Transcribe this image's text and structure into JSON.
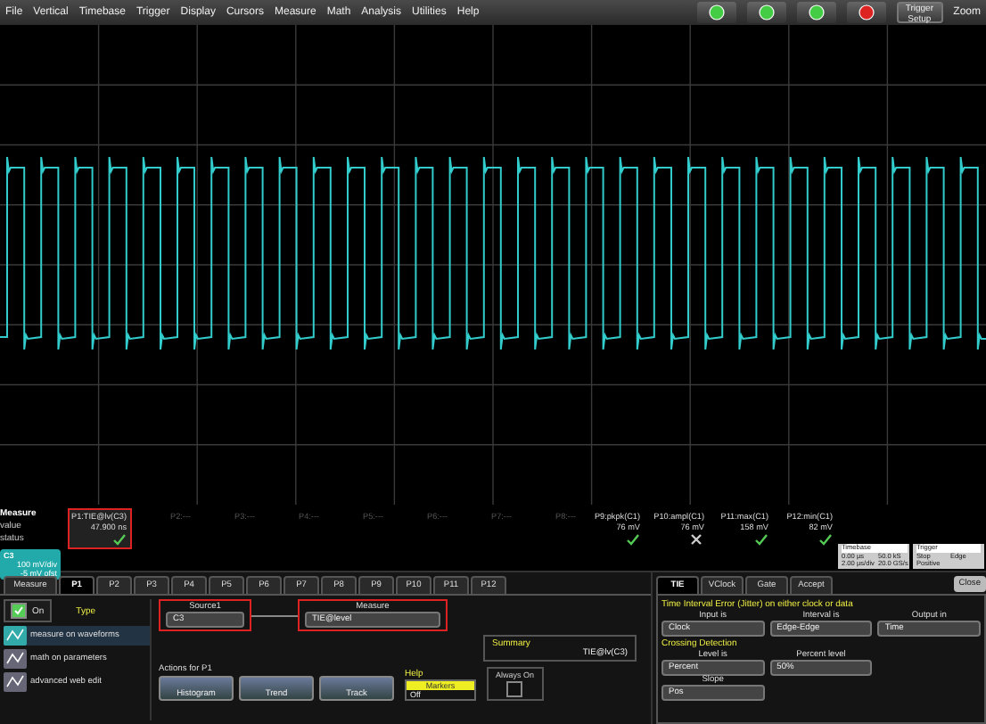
{
  "menu": [
    "File",
    "Vertical",
    "Timebase",
    "Trigger",
    "Display",
    "Cursors",
    "Measure",
    "Math",
    "Analysis",
    "Utilities",
    "Help"
  ],
  "toolbar": {
    "trigger_setup": "Trigger Setup",
    "zoom": "Zoom"
  },
  "measure_table": {
    "row_labels": [
      "Measure",
      "value",
      "status"
    ],
    "params": [
      {
        "label": "P1:TIE@lv(C3)",
        "value": "47.900 ns",
        "passed": true,
        "selected": true
      },
      {
        "label": "P2:---",
        "selected": false
      },
      {
        "label": "P3:---",
        "selected": false
      },
      {
        "label": "P4:---",
        "selected": false
      },
      {
        "label": "P5:---",
        "selected": false
      },
      {
        "label": "P6:---",
        "selected": false
      },
      {
        "label": "P7:---",
        "selected": false
      },
      {
        "label": "P8:---",
        "selected": false
      },
      {
        "label": "P9:pkpk(C1)",
        "value": "76 mV",
        "passed": true,
        "selected": false
      },
      {
        "label": "P10:ampl(C1)",
        "value": "76 mV",
        "passed": false,
        "selected": false
      },
      {
        "label": "P11:max(C1)",
        "value": "158 mV",
        "passed": true,
        "selected": false
      },
      {
        "label": "P12:min(C1)",
        "value": "82 mV",
        "passed": true,
        "selected": false
      }
    ]
  },
  "channel": {
    "name": "C3",
    "lines": [
      "100 mV/div",
      "-5 mV ofst"
    ]
  },
  "timebase": {
    "title": "Timebase",
    "cells": [
      "0.00 µs",
      "50.0 kS",
      "2.00 µs/div",
      "20.0 GS/s"
    ]
  },
  "trigger": {
    "title": "Trigger",
    "cells": [
      "Stop",
      "Edge",
      "Positive"
    ]
  },
  "tabs": [
    {
      "label": "Measure",
      "selected": false
    },
    {
      "label": "P1",
      "selected": true
    },
    {
      "label": "P2",
      "selected": false
    },
    {
      "label": "P3",
      "selected": false
    },
    {
      "label": "P4",
      "selected": false
    },
    {
      "label": "P5",
      "selected": false
    },
    {
      "label": "P6",
      "selected": false
    },
    {
      "label": "P7",
      "selected": false
    },
    {
      "label": "P8",
      "selected": false
    },
    {
      "label": "P9",
      "selected": false
    },
    {
      "label": "P10",
      "selected": false
    },
    {
      "label": "P11",
      "selected": false
    },
    {
      "label": "P12",
      "selected": false
    }
  ],
  "on": {
    "label": "On",
    "checked": true
  },
  "type_label": "Type",
  "types": [
    {
      "label": "measure on waveforms",
      "selected": true
    },
    {
      "label": "math on parameters",
      "selected": false
    },
    {
      "label": "advanced web edit",
      "selected": false
    }
  ],
  "source": {
    "label": "Source1",
    "value": "C3"
  },
  "measure": {
    "label": "Measure",
    "value": "TIE@level"
  },
  "summary": {
    "label": "Summary",
    "value": "TIE@lv(C3)"
  },
  "actions_label": "Actions for P1",
  "actions": [
    "Histogram",
    "Trend",
    "Track"
  ],
  "help": {
    "label": "Help",
    "markers_label": "Markers",
    "markers_value": "Off"
  },
  "always_on": {
    "label": "Always On",
    "checked": false
  },
  "sub_tabs": [
    {
      "label": "TIE",
      "selected": true
    },
    {
      "label": "VClock",
      "selected": false
    },
    {
      "label": "Gate",
      "selected": false
    },
    {
      "label": "Accept",
      "selected": false
    }
  ],
  "close": "Close",
  "description": "Time Interval Error (Jitter) on either clock or data",
  "fields": [
    {
      "label": "Input is",
      "value": "Clock"
    },
    {
      "label": "Interval is",
      "value": "Edge-Edge"
    },
    {
      "label": "Output in",
      "value": "Time"
    }
  ],
  "crossing_label": "Crossing Detection",
  "crossing_fields": [
    {
      "label": "Level is",
      "value": "Percent"
    },
    {
      "label": "Percent level",
      "value": "50%"
    }
  ],
  "slope": {
    "label": "Slope",
    "value": "Pos"
  }
}
